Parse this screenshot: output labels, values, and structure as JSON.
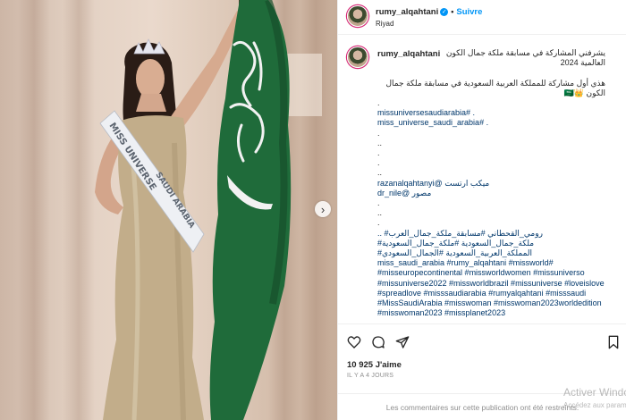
{
  "photo": {
    "sash_line1": "MISS UNIVERSE",
    "sash_line2": "SAUDI ARABIA",
    "next_label": "›"
  },
  "header": {
    "username": "rumy_alqahtani",
    "verified_glyph": "✓",
    "separator": "•",
    "follow_label": "Suivre",
    "location": "Riyad"
  },
  "caption": {
    "username": "rumy_alqahtani",
    "lines": [
      {
        "text": "يشرفني المشاركة في مسابقة ملكة جمال الكون",
        "dir": "rtl",
        "cls": "lead"
      },
      {
        "text": "العالمية 2024",
        "dir": "rtl",
        "cls": ""
      },
      {
        "text": "",
        "dir": "ltr",
        "cls": ""
      },
      {
        "text": "هذي أول مشاركة للمملكة العربية السعودية في مسابقة ملكة جمال",
        "dir": "rtl",
        "cls": ""
      },
      {
        "text": "الكون 👑🇸🇦",
        "dir": "rtl",
        "cls": ""
      },
      {
        "text": ".",
        "dir": "ltr",
        "cls": ""
      },
      {
        "text": "missuniversesaudiarabia# .",
        "dir": "ltr",
        "cls": "tag"
      },
      {
        "text": "miss_universe_saudi_arabia# .",
        "dir": "ltr",
        "cls": "tag"
      },
      {
        "text": ".",
        "dir": "ltr",
        "cls": ""
      },
      {
        "text": "..",
        "dir": "ltr",
        "cls": ""
      },
      {
        "text": ".",
        "dir": "ltr",
        "cls": ""
      },
      {
        "text": ".",
        "dir": "ltr",
        "cls": ""
      },
      {
        "text": "..",
        "dir": "ltr",
        "cls": ""
      },
      {
        "text": "razanalqahtanyi@ ميكب ارتست",
        "dir": "ltr",
        "cls": "tag"
      },
      {
        "text": "dr_nile@ مصور",
        "dir": "ltr",
        "cls": "tag"
      },
      {
        "text": ".",
        "dir": "ltr",
        "cls": ""
      },
      {
        "text": "..",
        "dir": "ltr",
        "cls": ""
      },
      {
        "text": ".",
        "dir": "ltr",
        "cls": ""
      },
      {
        "text": ".. #رومي_القحطاني #مسابقة_ملكة_جمال_العرب",
        "dir": "ltr",
        "cls": "tag"
      },
      {
        "text": "#ملكة_جمال_السعودية #ملكة_جمال_السعودية",
        "dir": "ltr",
        "cls": "tag"
      },
      {
        "text": "#المملكة_العربية_السعودية #الجمال_السعودي",
        "dir": "ltr",
        "cls": "tag"
      },
      {
        "text": "miss_saudi_arabia #rumy_alqahtani #missworld#",
        "dir": "ltr",
        "cls": "tag"
      },
      {
        "text": "#misseuropecontinental #missworldwomen #missuniverso",
        "dir": "ltr",
        "cls": "tag"
      },
      {
        "text": "#missuniverse2022 #missworldbrazil #missuniverse #loveislove",
        "dir": "ltr",
        "cls": "tag"
      },
      {
        "text": "#spreadlove #misssaudiarabia #rumyalqahtani #misssaudi",
        "dir": "ltr",
        "cls": "tag"
      },
      {
        "text": "#MissSaudiArabia #misswoman #misswoman2023worldedition",
        "dir": "ltr",
        "cls": "tag"
      },
      {
        "text": "#misswoman2023 #missplanet2023",
        "dir": "ltr",
        "cls": "tag"
      }
    ]
  },
  "actions": {
    "likes": "10 925 J'aime",
    "time": "IL Y A 4 JOURS"
  },
  "footer": {
    "comments_off": "Les commentaires sur cette publication ont été restreints."
  },
  "watermark": {
    "line1": "Activer Windows",
    "line2": "Accédez aux paramètres"
  },
  "colors": {
    "flag_green": "#1f6b3a",
    "link_blue": "#0095f6",
    "hashtag_blue": "#00376b"
  }
}
